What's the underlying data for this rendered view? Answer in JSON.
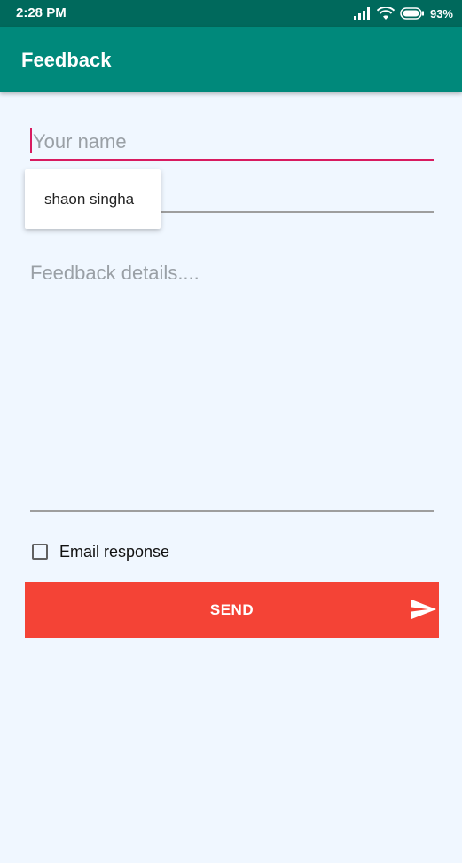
{
  "status_bar": {
    "time": "2:28 PM",
    "battery": "93%",
    "icons": [
      "signal-icon",
      "wifi-icon",
      "battery-icon"
    ]
  },
  "app_bar": {
    "title": "Feedback"
  },
  "form": {
    "name_placeholder": "Your name",
    "name_value": "",
    "email_value": "",
    "details_placeholder": "Feedback details....",
    "autocomplete_suggestion": "shaon singha",
    "checkbox_label": "Email response",
    "checkbox_checked": false,
    "send_label": "SEND"
  },
  "colors": {
    "status_bar": "#00695c",
    "app_bar": "#00897b",
    "background": "#f0f7ff",
    "focus_underline": "#d81b60",
    "send_button": "#f44336"
  }
}
